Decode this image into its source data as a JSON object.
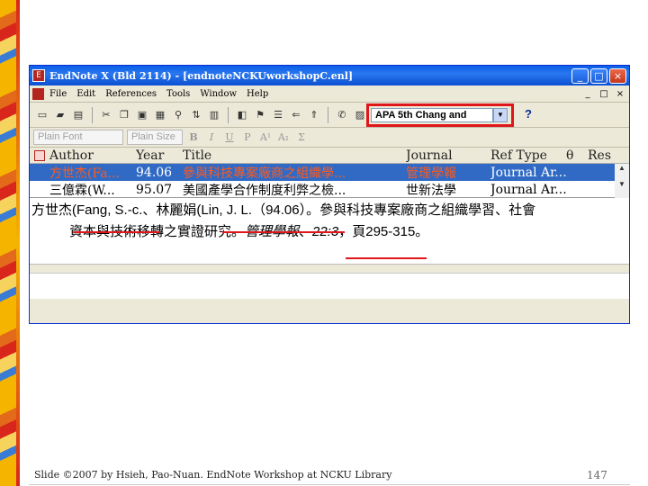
{
  "window": {
    "title": "EndNote X (Bld 2114) - [endnoteNCKUworkshopC.enl]",
    "icon_glyph": "E",
    "min": "_",
    "max": "□",
    "close": "×"
  },
  "menu": {
    "items": [
      "File",
      "Edit",
      "References",
      "Tools",
      "Window",
      "Help"
    ],
    "right": [
      "_",
      "□",
      "×"
    ]
  },
  "toolbar": {
    "style_value": "APA 5th Chang and",
    "style_arrow": "▼",
    "help": "?"
  },
  "formatbar": {
    "font": "Plain Font",
    "size": "Plain Size",
    "bold": "B",
    "italic": "I",
    "underline": "U",
    "plain": "P",
    "superscript": "A¹",
    "subscript": "A₁",
    "sigma": "Σ"
  },
  "reflist": {
    "headers": {
      "flag": "",
      "author": "Author",
      "year": "Year",
      "title": "Title",
      "journal": "Journal",
      "type": "Ref Type",
      "theta": "θ",
      "res": "Res"
    },
    "rows": [
      {
        "author": "方世杰(Fa...",
        "year": "94.06",
        "title": "參與科技專案廠商之組織學...",
        "journal": "管理學報",
        "type": "Journal Ar...",
        "selected": true
      },
      {
        "author": "三億霖(W...",
        "year": "95.07",
        "title": "美國產學合作制度利弊之檢...",
        "journal": "世新法學",
        "type": "Journal Ar...",
        "selected": false
      }
    ]
  },
  "preview": {
    "p1": "方世杰(",
    "author_en": "Fang, S.-c.",
    "p2": "、林麗娟(",
    "author2_en": "Lin, J. L.",
    "p3": "（",
    "year": "94.06",
    "p4": "）。參與科技專案廠商之組織學習、社會",
    "line2_a": "資本與技術移轉之實證研究。",
    "journal": "管理學報",
    "p5": "、",
    "volume": "22:3",
    "p6": "，頁295-315。"
  },
  "slide": {
    "footer": "Slide ©2007 by Hsieh, Pao-Nuan. EndNote Workshop at NCKU Library",
    "page": "147"
  }
}
